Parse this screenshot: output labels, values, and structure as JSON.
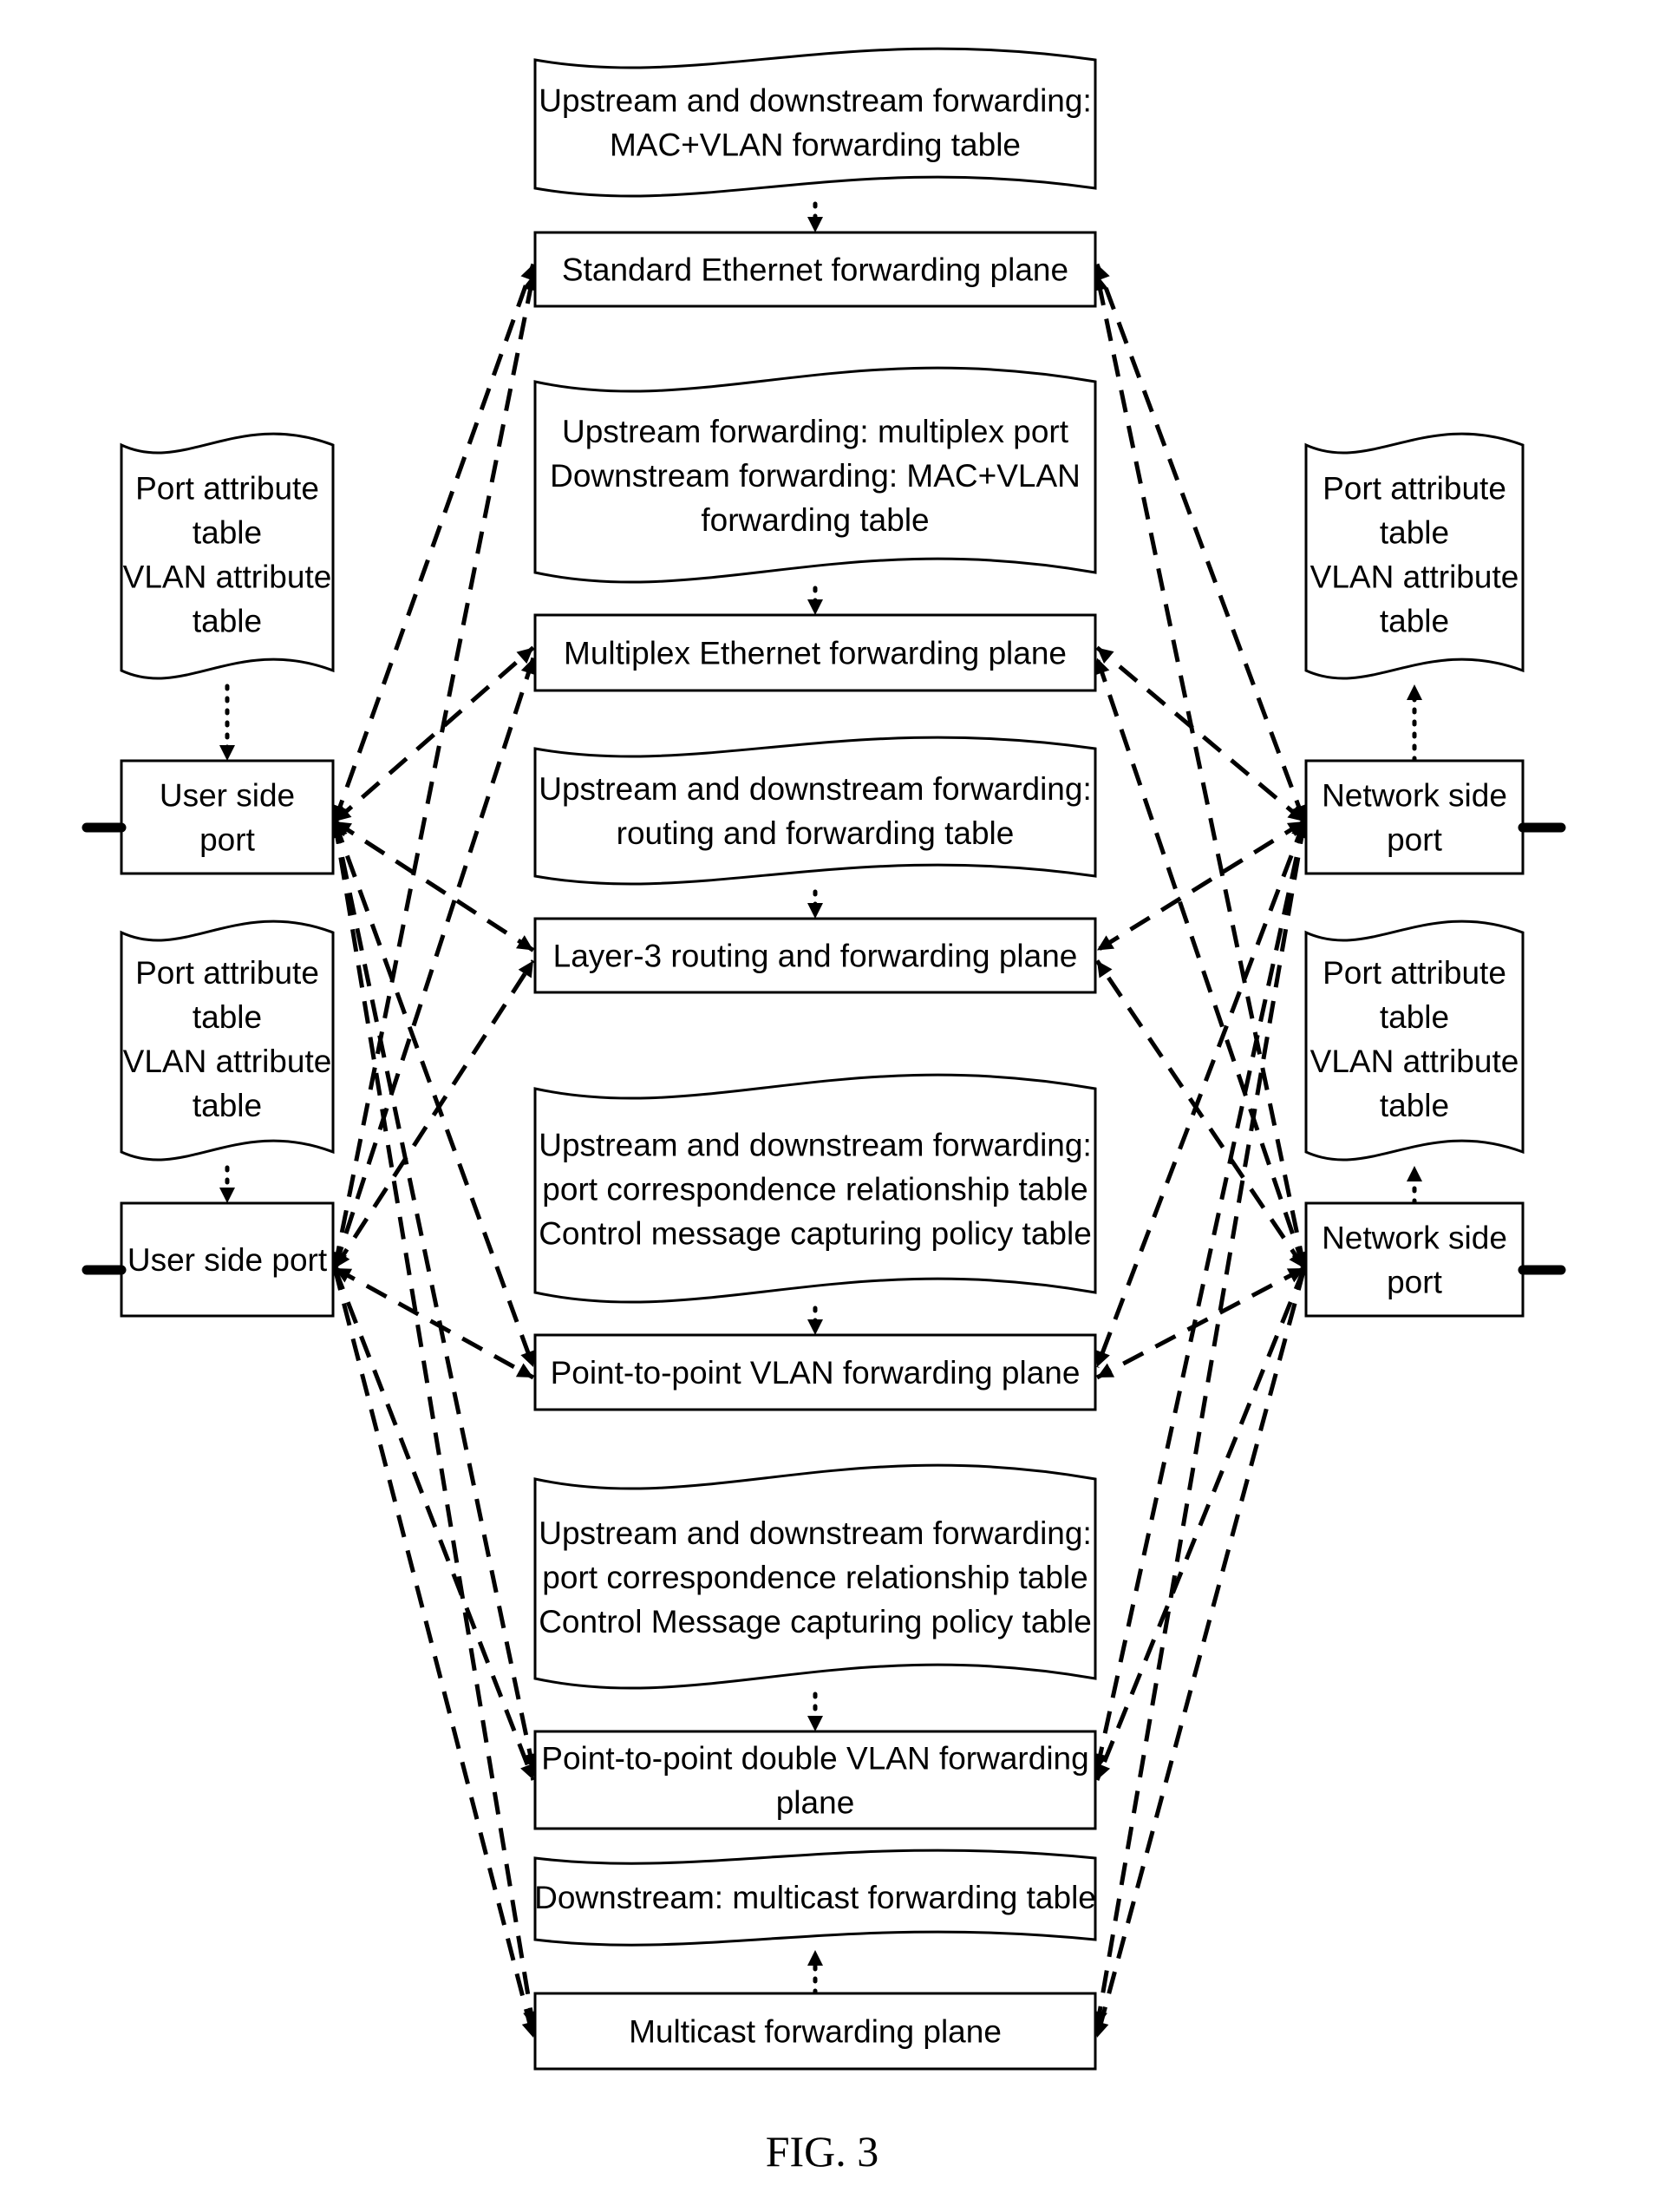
{
  "figure": {
    "caption": "FIG. 3"
  },
  "planes": [
    {
      "id": "standard-ethernet",
      "lines": [
        "Standard Ethernet forwarding plane"
      ]
    },
    {
      "id": "multiplex-ethernet",
      "lines": [
        "Multiplex Ethernet forwarding plane"
      ]
    },
    {
      "id": "layer3-routing",
      "lines": [
        "Layer-3 routing and forwarding plane"
      ]
    },
    {
      "id": "p2p-vlan",
      "lines": [
        "Point-to-point VLAN forwarding plane"
      ]
    },
    {
      "id": "p2p-double-vlan",
      "lines": [
        "Point-to-point double VLAN forwarding",
        "plane"
      ]
    },
    {
      "id": "multicast",
      "lines": [
        "Multicast forwarding plane"
      ]
    }
  ],
  "plane_tables": [
    {
      "plane": "standard-ethernet",
      "arrow": "to-plane",
      "lines": [
        "Upstream and downstream forwarding:",
        "MAC+VLAN forwarding table"
      ]
    },
    {
      "plane": "multiplex-ethernet",
      "arrow": "to-plane",
      "lines": [
        "Upstream forwarding: multiplex port",
        "Downstream forwarding: MAC+VLAN",
        "forwarding table"
      ]
    },
    {
      "plane": "layer3-routing",
      "arrow": "to-plane",
      "lines": [
        "Upstream and downstream forwarding:",
        "routing and forwarding table"
      ]
    },
    {
      "plane": "p2p-vlan",
      "arrow": "to-plane",
      "lines": [
        "Upstream and downstream forwarding:",
        "port correspondence relationship table",
        "Control message capturing policy table"
      ]
    },
    {
      "plane": "p2p-double-vlan",
      "arrow": "to-plane",
      "lines": [
        "Upstream and downstream forwarding:",
        "port correspondence relationship table",
        "Control Message capturing policy table"
      ]
    },
    {
      "plane": "multicast",
      "arrow": "to-table",
      "lines": [
        "Downstream: multicast forwarding table"
      ]
    }
  ],
  "user_ports": [
    {
      "id": "user-port-1",
      "lines": [
        "User side",
        "port"
      ],
      "table": {
        "arrow": "to-port",
        "lines": [
          "Port attribute",
          "table",
          "VLAN attribute",
          "table"
        ]
      }
    },
    {
      "id": "user-port-2",
      "lines": [
        "User side port"
      ],
      "table": {
        "arrow": "to-port",
        "lines": [
          "Port attribute",
          "table",
          "VLAN attribute",
          "table"
        ]
      }
    }
  ],
  "network_ports": [
    {
      "id": "network-port-1",
      "lines": [
        "Network side",
        "port"
      ],
      "table": {
        "arrow": "to-table",
        "lines": [
          "Port attribute",
          "table",
          "VLAN attribute",
          "table"
        ]
      }
    },
    {
      "id": "network-port-2",
      "lines": [
        "Network side",
        "port"
      ],
      "table": {
        "arrow": "to-table",
        "lines": [
          "Port attribute",
          "table",
          "VLAN attribute",
          "table"
        ]
      }
    }
  ],
  "connections": {
    "style": "dashed",
    "description": "Every user side port and every network side port connects to every forwarding plane",
    "bidirectional_planes": [
      "standard-ethernet",
      "multiplex-ethernet",
      "layer3-routing",
      "p2p-vlan"
    ],
    "to_plane_only": [
      "p2p-double-vlan",
      "multicast"
    ]
  }
}
